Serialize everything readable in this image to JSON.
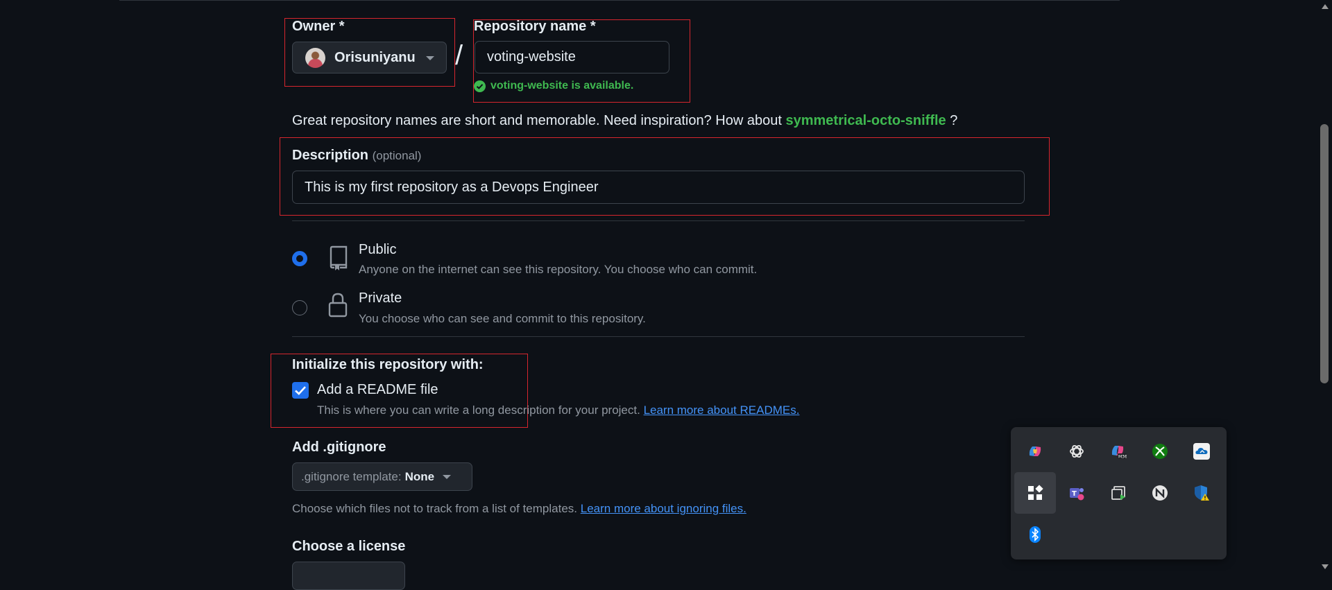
{
  "owner": {
    "label": "Owner *",
    "value": "Orisuniyanu"
  },
  "separator": "/",
  "repo": {
    "label": "Repository name *",
    "value": "voting-website",
    "availability": "voting-website is available."
  },
  "hint": {
    "prefix": "Great repository names are short and memorable. Need inspiration? How about",
    "suggestion": "symmetrical-octo-sniffle",
    "suffix": "?"
  },
  "description": {
    "label": "Description",
    "optional": "(optional)",
    "value": "This is my first repository as a Devops Engineer"
  },
  "visibility": {
    "selected": "public",
    "public": {
      "title": "Public",
      "desc": "Anyone on the internet can see this repository. You choose who can commit."
    },
    "private": {
      "title": "Private",
      "desc": "You choose who can see and commit to this repository."
    }
  },
  "initialize": {
    "heading": "Initialize this repository with:",
    "readme_label": "Add a README file",
    "readme_checked": true,
    "readme_desc": "This is where you can write a long description for your project.",
    "readme_link": "Learn more about READMEs."
  },
  "gitignore": {
    "heading": "Add .gitignore",
    "select_prefix": ".gitignore template:",
    "select_value": "None",
    "desc": "Choose which files not to track from a list of templates.",
    "link": "Learn more about ignoring files."
  },
  "license": {
    "heading": "Choose a license"
  },
  "tray_icons": [
    "copilot-icon",
    "openai-icon",
    "copilot-m365-icon",
    "xbox-icon",
    "onedrive-icon",
    "app-icon",
    "teams-icon",
    "screen-capture-icon",
    "network-icon",
    "defender-icon",
    "bluetooth-icon"
  ],
  "colors": {
    "accent": "#1f6feb",
    "success": "#3fb950",
    "link": "#4493f8",
    "background": "#0d1117",
    "highlight_box": "#d7262e"
  }
}
